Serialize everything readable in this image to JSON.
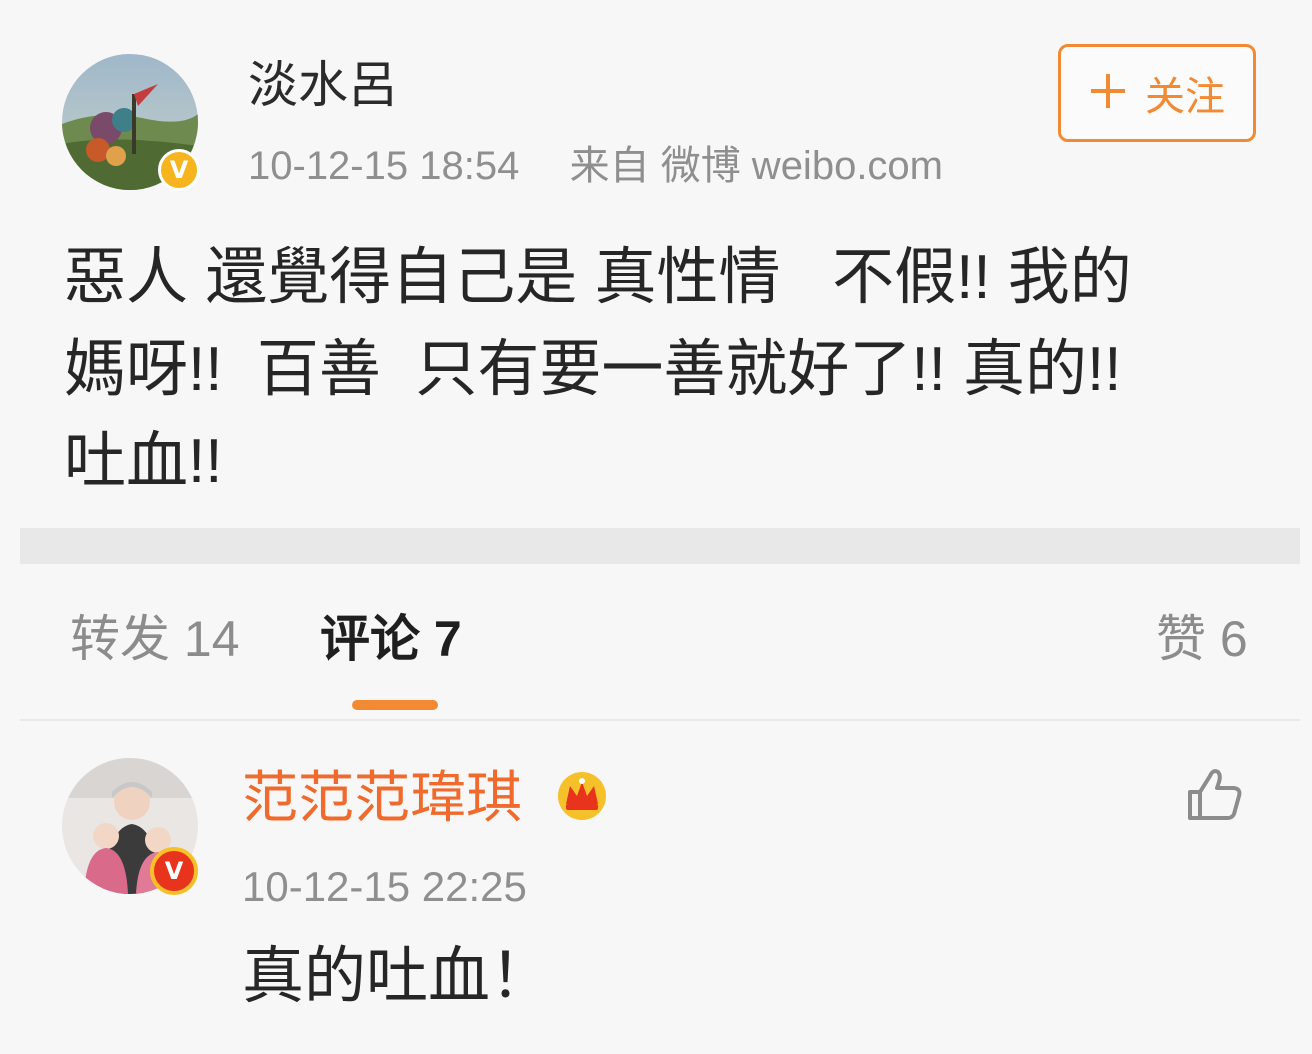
{
  "post": {
    "author": "淡水呂",
    "timestamp": "10-12-15 18:54",
    "source": "来自 微博 weibo.com",
    "follow_button": {
      "icon": "plus-icon",
      "label": "关注"
    },
    "text": "惡人 還覺得自己是 真性情   不假!! 我的\n媽呀!!  百善  只有要一善就好了!! 真的!!\n吐血!!",
    "verified_badge": "V"
  },
  "tabs": [
    {
      "label": "转发 14"
    },
    {
      "label": "评论 7"
    },
    {
      "label": "赞 6"
    }
  ],
  "comment": {
    "author": "范范范瑋琪",
    "timestamp": "10-12-15 22:25",
    "text": "真的吐血！",
    "verified_badge": "V",
    "badge_icon": "crown-icon",
    "like_icon": "thumbs-up-icon"
  },
  "colors": {
    "accent_orange": "#f28a33",
    "commenter_name": "#ef6a2c",
    "verified_gold": "#f6b51e",
    "verified_red": "#e8341c"
  }
}
